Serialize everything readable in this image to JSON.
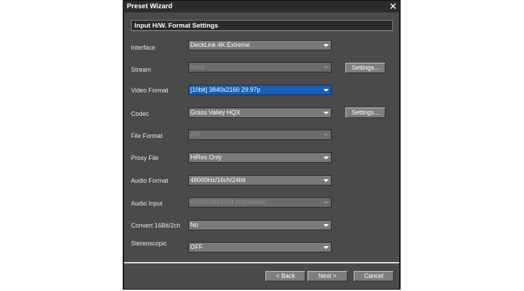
{
  "window": {
    "title": "Preset Wizard"
  },
  "section_title": "Input H/W. Format Settings",
  "fields": {
    "interface": {
      "label": "Interface",
      "value": "DeckLink 4K Extreme"
    },
    "stream": {
      "label": "Stream",
      "value": "Input",
      "settings": "Settings..."
    },
    "video_format": {
      "label": "Video Format",
      "value": "[10bit] 3840x2160 29.97p"
    },
    "codec": {
      "label": "Codec",
      "value": "Grass Valley HQX",
      "settings": "Settings..."
    },
    "file_format": {
      "label": "File Format",
      "value": "AVI"
    },
    "proxy_file": {
      "label": "Proxy File",
      "value": "HiRes Only"
    },
    "audio_format": {
      "label": "Audio Format",
      "value": "48000Hz/16ch/24bit"
    },
    "audio_input": {
      "label": "Audio Input",
      "value": "SDI/HDMI/1394 embedded"
    },
    "convert": {
      "label": "Convert 16Bit/2ch",
      "value": "No"
    },
    "stereoscopic": {
      "label": "Stereoscopic",
      "value": "OFF"
    }
  },
  "buttons": {
    "back": "< Back",
    "next": "Next >",
    "cancel": "Cancel"
  },
  "icons": {
    "close": "close-icon",
    "dropdown": "chevron-down-icon"
  }
}
